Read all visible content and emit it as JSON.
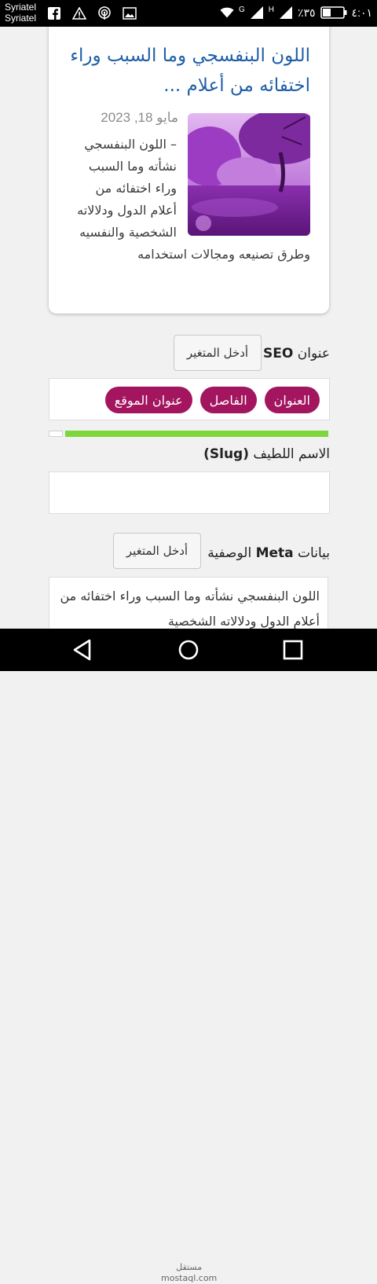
{
  "status_bar": {
    "carrier_1": "Syriatel",
    "carrier_2": "Syriatel",
    "battery": "٪٣٥",
    "time": "٤:٠١",
    "net_1": "G",
    "net_2": "H",
    "icons": [
      "facebook-icon",
      "warning-icon",
      "hotspot-icon",
      "image-icon",
      "wifi-icon",
      "signal-icon",
      "battery-icon"
    ]
  },
  "post": {
    "title": "اللون البنفسجي وما السبب وراء اختفائه من أعلام ...",
    "date": "مايو 18, 2023",
    "excerpt": "– اللون البنفسجي نشأته وما السبب وراء اختفائه من أعلام الدول ودلالاته الشخصية والنفسيه وطرق تصنيعه ومجالات استخدامه"
  },
  "seo_title": {
    "label_prefix": "عنوان",
    "label_bold": "SEO",
    "var_button": "أدخل المتغير",
    "tags": [
      "العنوان",
      "الفاصل",
      "عنوان الموقع"
    ]
  },
  "progress": {
    "value_percent": 95
  },
  "slug": {
    "label_prefix": "الاسم اللطيف",
    "label_bold": "(Slug)",
    "value": ""
  },
  "meta": {
    "label_prefix": "بيانات",
    "label_bold": "Meta",
    "label_suffix": "الوصفية",
    "var_button": "أدخل المتغير",
    "value": "اللون البنفسجي نشأته وما السبب وراء اختفائه من أعلام الدول ودلالاته الشخصية"
  },
  "watermark": "مستقل\nmostaql.com",
  "colors": {
    "accent": "#1e5ea8",
    "tag": "#a3155f",
    "progress": "#7dd63b"
  }
}
